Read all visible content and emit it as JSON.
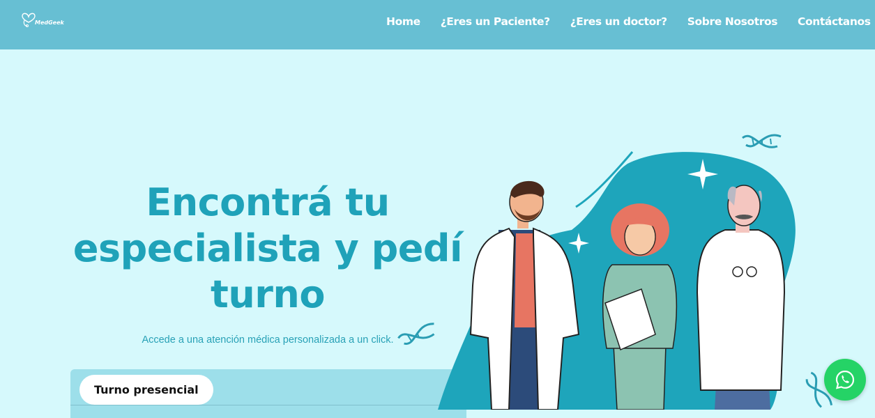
{
  "brand": {
    "name": "MedGeek"
  },
  "nav": {
    "items": [
      {
        "label": "Home"
      },
      {
        "label": "¿Eres un Paciente?"
      },
      {
        "label": "¿Eres un doctor?"
      },
      {
        "label": "Sobre Nosotros"
      },
      {
        "label": "Contáctanos"
      }
    ]
  },
  "hero": {
    "title": "Encontrá tu especialista y pedí turno",
    "subtitle": "Accede a una atención médica personalizada a un click."
  },
  "booking": {
    "tabs": [
      {
        "label": "Turno presencial"
      }
    ]
  },
  "colors": {
    "navbar": "#67bfd3",
    "background": "#d6f9fc",
    "accent": "#1fa2b9",
    "blob": "#1ea5bb",
    "whatsapp": "#25d366"
  },
  "icons": {
    "logo": "heart-stethoscope-icon",
    "whatsapp": "whatsapp-icon",
    "dna": "dna-icon",
    "sparkle": "sparkle-icon"
  }
}
